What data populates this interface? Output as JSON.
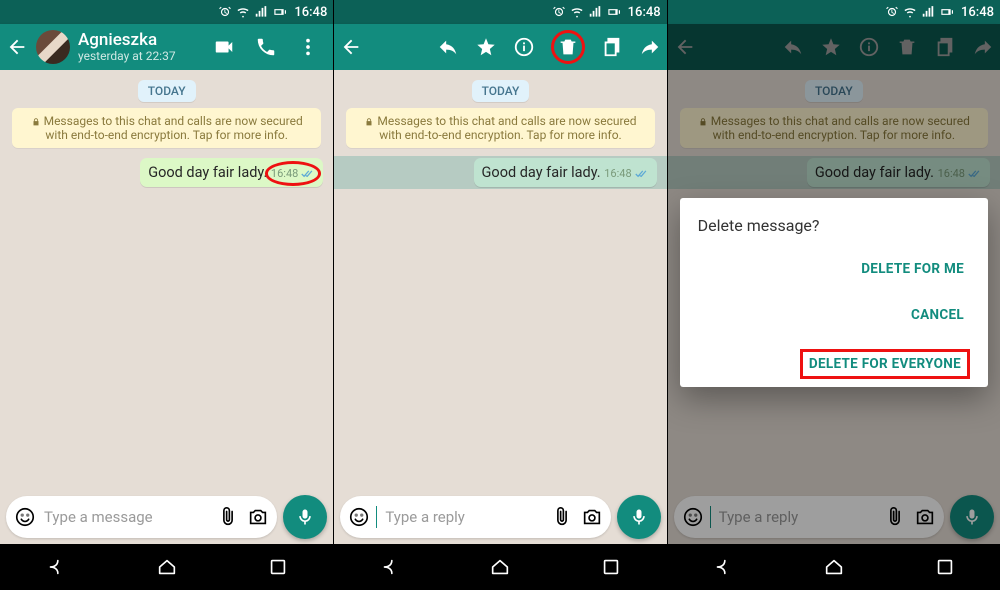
{
  "status": {
    "time": "16:48"
  },
  "chat": {
    "name": "Agnieszka",
    "subtitle": "yesterday at 22:37",
    "day_label": "TODAY",
    "encryption_text": "Messages to this chat and calls are now secured with end-to-end encryption. Tap for more info."
  },
  "message": {
    "text": "Good day fair lady.",
    "time": "16:48"
  },
  "compose": {
    "placeholder_message": "Type a message",
    "placeholder_reply": "Type a reply"
  },
  "dialog": {
    "title": "Delete message?",
    "delete_me": "DELETE FOR ME",
    "cancel": "CANCEL",
    "delete_all": "DELETE FOR EVERYONE"
  }
}
